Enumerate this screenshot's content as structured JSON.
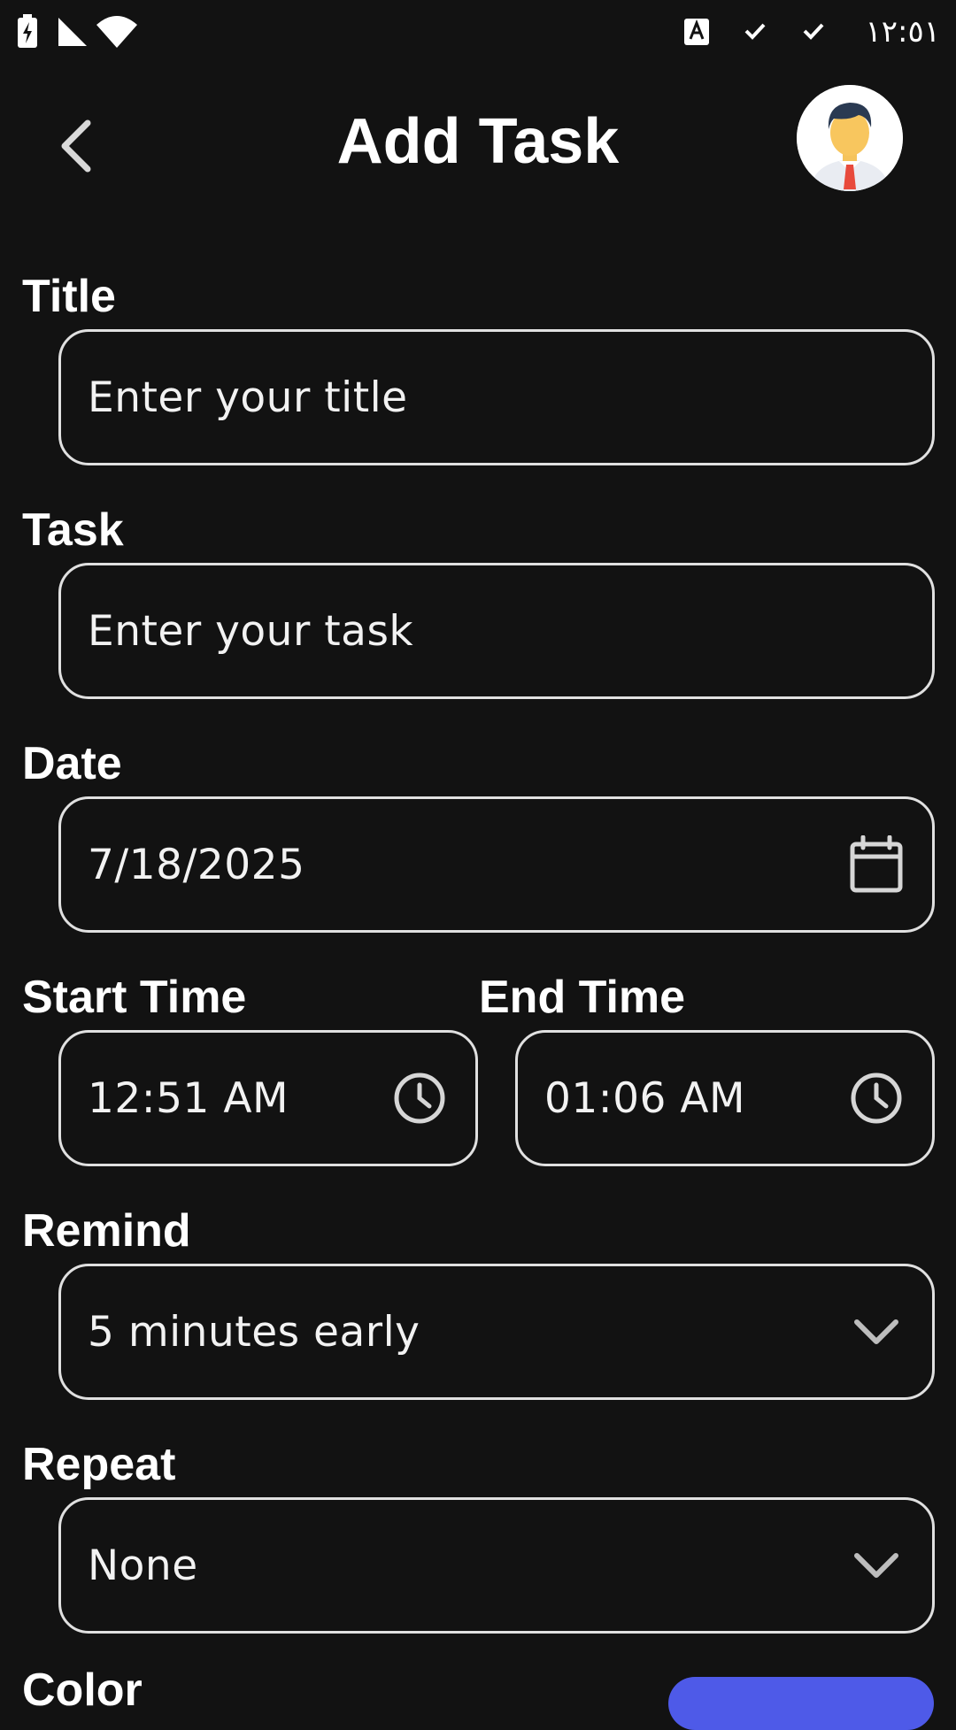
{
  "status_bar": {
    "time": "١٢:٥١",
    "icons": [
      "battery-charging-icon",
      "cell-signal-icon",
      "wifi-icon",
      "keyboard-icon",
      "check-icon",
      "check-icon"
    ]
  },
  "header": {
    "title": "Add Task",
    "back_icon": "chevron-left-icon",
    "avatar_icon": "user-avatar"
  },
  "form": {
    "title": {
      "label": "Title",
      "placeholder": "Enter your title"
    },
    "task": {
      "label": "Task",
      "placeholder": "Enter your task"
    },
    "date": {
      "label": "Date",
      "value": "7/18/2025",
      "icon": "calendar-icon"
    },
    "start_time": {
      "label": "Start Time",
      "value": "12:51 AM",
      "icon": "clock-icon"
    },
    "end_time": {
      "label": "End Time",
      "value": "01:06 AM",
      "icon": "clock-icon"
    },
    "remind": {
      "label": "Remind",
      "value": "5 minutes early",
      "icon": "chevron-down-icon"
    },
    "repeat": {
      "label": "Repeat",
      "value": "None",
      "icon": "chevron-down-icon"
    },
    "color": {
      "label": "Color"
    }
  },
  "colors": {
    "background": "#121212",
    "border": "#e0e0e0",
    "accent": "#4e5ae8"
  }
}
